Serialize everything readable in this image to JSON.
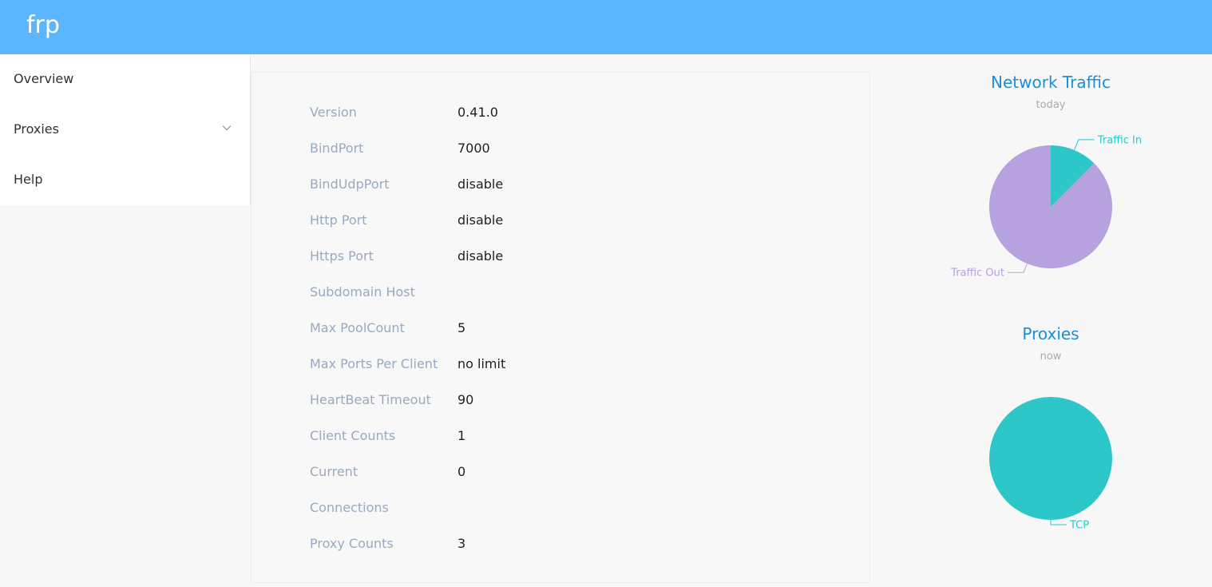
{
  "app": {
    "brand": "frp"
  },
  "sidebar": {
    "items": [
      {
        "label": "Overview"
      },
      {
        "label": "Proxies",
        "icon": "chevron-down-icon"
      },
      {
        "label": "Help"
      }
    ]
  },
  "overview": {
    "rows": [
      {
        "label": "Version",
        "value": "0.41.0"
      },
      {
        "label": "BindPort",
        "value": "7000"
      },
      {
        "label": "BindUdpPort",
        "value": "disable"
      },
      {
        "label": "Http Port",
        "value": "disable"
      },
      {
        "label": "Https Port",
        "value": "disable"
      },
      {
        "label": "Subdomain Host",
        "value": ""
      },
      {
        "label": "Max PoolCount",
        "value": "5"
      },
      {
        "label": "Max Ports Per Client",
        "value": "no limit"
      },
      {
        "label": "HeartBeat Timeout",
        "value": "90"
      },
      {
        "label": "Client Counts",
        "value": "1"
      },
      {
        "label": "Current",
        "value": "0"
      },
      {
        "label": "Connections",
        "value": ""
      },
      {
        "label": "Proxy Counts",
        "value": "3"
      }
    ]
  },
  "colors": {
    "header": "#5cb6ff",
    "chart_title": "#1a8fd8",
    "traffic_in": "#2ec7c9",
    "traffic_out": "#b6a2de",
    "tcp": "#2ec7c9"
  },
  "chart_data": [
    {
      "type": "pie",
      "title": "Network Traffic",
      "subtitle": "today",
      "categories": [
        "Traffic In",
        "Traffic Out"
      ],
      "values": [
        12.5,
        87.5
      ],
      "colors": [
        "#2ec7c9",
        "#b6a2de"
      ]
    },
    {
      "type": "pie",
      "title": "Proxies",
      "subtitle": "now",
      "categories": [
        "TCP"
      ],
      "values": [
        3
      ],
      "colors": [
        "#2ec7c9"
      ]
    }
  ]
}
